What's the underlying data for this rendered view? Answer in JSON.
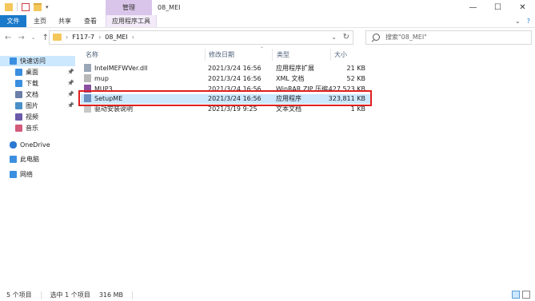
{
  "window": {
    "title": "08_MEI",
    "context_tab": "管理",
    "controls": [
      "—",
      "☐",
      "✕"
    ]
  },
  "ribbon": {
    "file": "文件",
    "tabs": [
      "主页",
      "共享",
      "查看"
    ],
    "tools": "应用程序工具",
    "right": [
      "⌄",
      "?"
    ]
  },
  "address": {
    "segments": [
      "›",
      "F117-7",
      "›",
      "08_MEI",
      "›"
    ],
    "chevron": "⌄",
    "refresh": "↻"
  },
  "search": {
    "placeholder": "搜索\"08_MEI\""
  },
  "nav_pane": {
    "items": [
      {
        "label": "快速访问",
        "icon": "star-icon",
        "color": "#3a8fe0",
        "pinned": false
      },
      {
        "label": "桌面",
        "icon": "desktop-icon",
        "color": "#3a8fe0",
        "pinned": true
      },
      {
        "label": "下载",
        "icon": "download-icon",
        "color": "#3a8fe0",
        "pinned": true
      },
      {
        "label": "文档",
        "icon": "document-icon",
        "color": "#6b7fa8",
        "pinned": true
      },
      {
        "label": "图片",
        "icon": "picture-icon",
        "color": "#4a90c8",
        "pinned": true
      },
      {
        "label": "视频",
        "icon": "video-icon",
        "color": "#6b5aa8",
        "pinned": false
      },
      {
        "label": "音乐",
        "icon": "music-icon",
        "color": "#d25a7a",
        "pinned": false
      },
      {
        "label": "OneDrive",
        "icon": "cloud-icon",
        "color": "#2b78d2",
        "pinned": false
      },
      {
        "label": "此电脑",
        "icon": "computer-icon",
        "color": "#3a8fe0",
        "pinned": false
      },
      {
        "label": "网络",
        "icon": "network-icon",
        "color": "#3a8fe0",
        "pinned": false
      }
    ]
  },
  "columns": [
    "名称",
    "修改日期",
    "类型",
    "大小"
  ],
  "files": [
    {
      "name": "IntelMEFWVer.dll",
      "date": "2021/3/24 16:56",
      "type": "应用程序扩展",
      "size": "21 KB",
      "icon": "dll-file-icon",
      "selected": false
    },
    {
      "name": "mup",
      "date": "2021/3/24 16:56",
      "type": "XML 文档",
      "size": "52 KB",
      "icon": "xml-file-icon",
      "selected": false
    },
    {
      "name": "MUP3",
      "date": "2021/3/24 16:56",
      "type": "WinRAR ZIP 压缩...",
      "size": "427,523 KB",
      "icon": "zip-file-icon",
      "selected": false
    },
    {
      "name": "SetupME",
      "date": "2021/3/24 16:56",
      "type": "应用程序",
      "size": "323,811 KB",
      "icon": "exe-file-icon",
      "selected": true
    },
    {
      "name": "驱动安装说明",
      "date": "2021/3/19 9:25",
      "type": "文本文档",
      "size": "1 KB",
      "icon": "text-file-icon",
      "selected": false
    }
  ],
  "status": {
    "count": "5 个项目",
    "selection": "选中 1 个项目",
    "size": "316 MB"
  },
  "accent": "#1979ca",
  "highlight_color": "#e02020"
}
